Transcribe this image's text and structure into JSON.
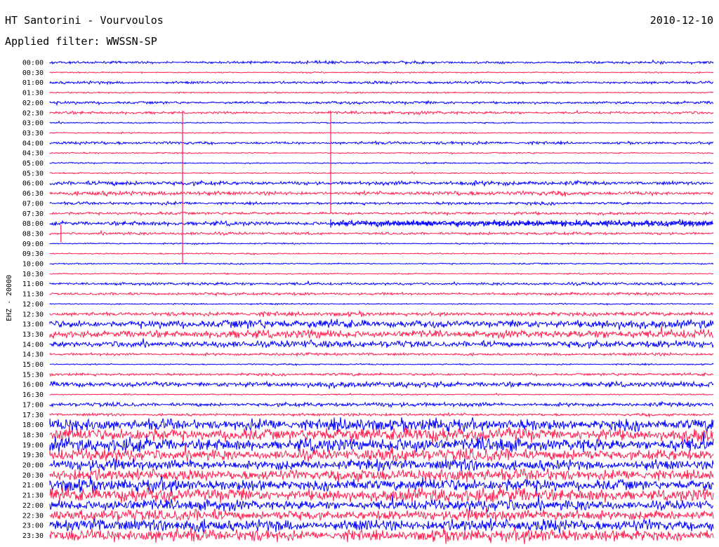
{
  "header": {
    "station": "HT Santorini - Vourvoulos",
    "date": "2010-12-10",
    "filter_prefix": "Applied filter:",
    "filter_name": "WWSSN-SP"
  },
  "chart_data": {
    "type": "line",
    "title": "HT Santorini - Vourvoulos",
    "ylabel": "EHZ - 20000",
    "colors": [
      "#0000ff",
      "#ff2050"
    ],
    "row_labels": [
      "00:00",
      "00:30",
      "01:00",
      "01:30",
      "02:00",
      "02:30",
      "03:00",
      "03:30",
      "04:00",
      "04:30",
      "05:00",
      "05:30",
      "06:00",
      "06:30",
      "07:00",
      "07:30",
      "08:00",
      "08:30",
      "09:00",
      "09:30",
      "10:00",
      "10:30",
      "11:00",
      "11:30",
      "12:00",
      "12:30",
      "13:00",
      "13:30",
      "14:00",
      "14:30",
      "15:00",
      "15:30",
      "16:00",
      "16:30",
      "17:00",
      "17:30",
      "18:00",
      "18:30",
      "19:00",
      "19:30",
      "20:00",
      "20:30",
      "21:00",
      "21:30",
      "22:00",
      "22:30",
      "23:00",
      "23:30"
    ],
    "series": [
      {
        "values": [
          2,
          1,
          2,
          1,
          2,
          2,
          1,
          1,
          2,
          1,
          1,
          1,
          3,
          3,
          2,
          2,
          3,
          2,
          1,
          1,
          1,
          1,
          2,
          2,
          1,
          3,
          6,
          6,
          5,
          2,
          1,
          2,
          4,
          1,
          3,
          2,
          9,
          10,
          10,
          9,
          8,
          9,
          9,
          10,
          8,
          8,
          9,
          9
        ]
      }
    ],
    "events": [
      {
        "row": "02:30",
        "minute": 6,
        "span_rows": 15,
        "amplitude": 300
      },
      {
        "row": "02:30",
        "minute": 12.7,
        "span_rows": 10,
        "amplitude": 300
      },
      {
        "row": "08:00",
        "minute": 12.7,
        "span_rows": 1,
        "amplitude": 12,
        "note": ""
      },
      {
        "row": "08:30",
        "minute": 0.5,
        "span_rows": 1,
        "amplitude": 25
      }
    ]
  }
}
